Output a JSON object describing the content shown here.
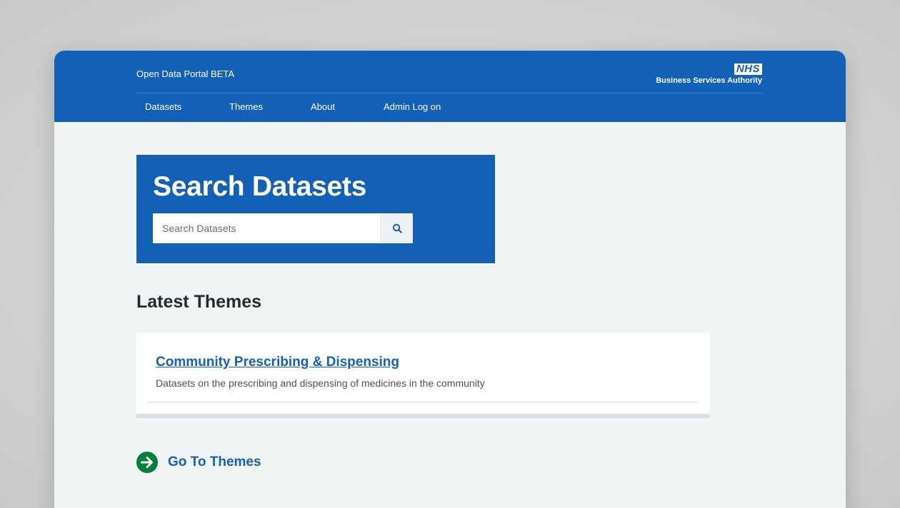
{
  "header": {
    "portal_title": "Open Data Portal BETA",
    "logo": {
      "badge": "NHS",
      "org": "Business Services Authority"
    },
    "nav": [
      {
        "label": "Datasets"
      },
      {
        "label": "Themes"
      },
      {
        "label": "About"
      },
      {
        "label": "Admin Log on"
      }
    ]
  },
  "search": {
    "title": "Search Datasets",
    "placeholder": "Search Datasets",
    "value": "",
    "button_icon": "search-icon"
  },
  "latest_themes": {
    "heading": "Latest Themes",
    "items": [
      {
        "title": "Community Prescribing & Dispensing",
        "description": "Datasets on the prescribing and dispensing of medicines in the community"
      }
    ]
  },
  "go_to_themes": {
    "label": "Go To Themes",
    "icon": "arrow-right-circle-icon"
  },
  "colors": {
    "brand_blue": "#1361b6",
    "page_background": "#f0f4f5",
    "go_icon_green": "#007f3b"
  }
}
